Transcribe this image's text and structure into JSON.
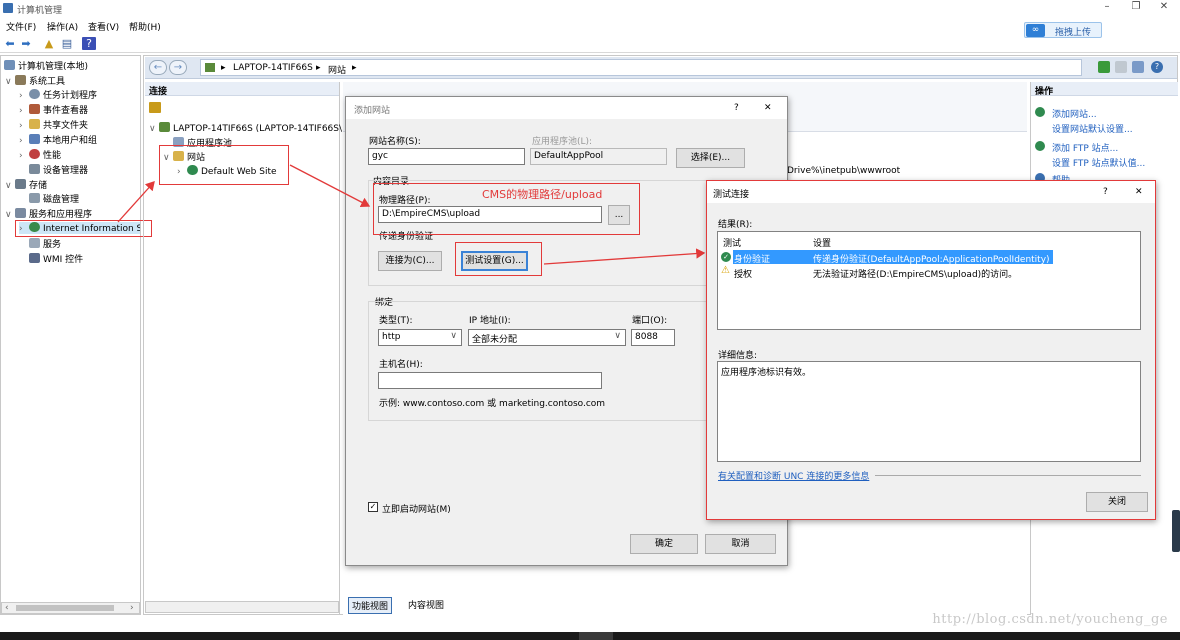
{
  "window": {
    "title": "计算机管理",
    "controls": [
      "–",
      "❐",
      "✕"
    ]
  },
  "menu": [
    "文件(F)",
    "操作(A)",
    "查看(V)",
    "帮助(H)"
  ],
  "upload_button": "拖拽上传",
  "left_tree": {
    "root": "计算机管理(本地)",
    "items": [
      {
        "label": "系统工具"
      },
      {
        "label": "任务计划程序"
      },
      {
        "label": "事件查看器"
      },
      {
        "label": "共享文件夹"
      },
      {
        "label": "本地用户和组"
      },
      {
        "label": "性能"
      },
      {
        "label": "设备管理器"
      },
      {
        "label": "存储"
      },
      {
        "label": "磁盘管理"
      },
      {
        "label": "服务和应用程序"
      },
      {
        "label": "Internet Information S"
      },
      {
        "label": "服务"
      },
      {
        "label": "WMI 控件"
      }
    ]
  },
  "address": {
    "crumbs": [
      "▸",
      "LAPTOP-14TIF66S",
      "▸",
      "网站",
      "▸"
    ]
  },
  "connections": {
    "header": "连接",
    "server": "LAPTOP-14TIF66S (LAPTOP-14TIF66S\\",
    "apppools": "应用程序池",
    "sites": "网站",
    "default_site": "Default Web Site"
  },
  "middle": {
    "path_fragment": "Drive%\\inetpub\\wwwroot"
  },
  "actions": {
    "header": "操作",
    "items": [
      "添加网站...",
      "设置网站默认设置...",
      "添加 FTP 站点...",
      "设置 FTP 站点默认值...",
      "帮助"
    ]
  },
  "view_tabs": [
    "功能视图",
    "内容视图"
  ],
  "add_site_dialog": {
    "title": "添加网站",
    "help": "?",
    "close": "✕",
    "site_name_label": "网站名称(S):",
    "site_name_value": "gyc",
    "app_pool_label": "应用程序池(L):",
    "app_pool_value": "DefaultAppPool",
    "select_button": "选择(E)...",
    "content_dir_label": "内容目录",
    "physical_path_label": "物理路径(P):",
    "physical_path_value": "D:\\EmpireCMS\\upload",
    "browse_button": "...",
    "passthrough_label": "传递身份验证",
    "connect_as_button": "连接为(C)...",
    "test_settings_button": "测试设置(G)...",
    "binding_label": "绑定",
    "type_label": "类型(T):",
    "type_value": "http",
    "ip_label": "IP 地址(I):",
    "ip_value": "全部未分配",
    "port_label": "端口(O):",
    "port_value": "8088",
    "hostname_label": "主机名(H):",
    "hostname_value": "",
    "example_text": "示例: www.contoso.com 或 marketing.contoso.com",
    "start_immediately_label": "立即启动网站(M)",
    "start_immediately_checked": true,
    "ok_button": "确定",
    "cancel_button": "取消"
  },
  "annotation": {
    "text": "CMS的物理路径/upload",
    "color": "#e23a3a"
  },
  "test_dialog": {
    "title": "测试连接",
    "help": "?",
    "close": "✕",
    "results_label": "结果(R):",
    "columns": [
      "测试",
      "设置"
    ],
    "rows": [
      {
        "test": "身份验证",
        "setting": "传递身份验证(DefaultAppPool:ApplicationPoolIdentity)",
        "status": "ok"
      },
      {
        "test": "授权",
        "setting": "无法验证对路径(D:\\EmpireCMS\\upload)的访问。",
        "status": "warning"
      }
    ],
    "details_label": "详细信息:",
    "details_text": "应用程序池标识有效。",
    "link_text": "有关配置和诊断 UNC 连接的更多信息",
    "close_button": "关闭"
  },
  "watermark": "http://blog.csdn.net/youcheng_ge"
}
